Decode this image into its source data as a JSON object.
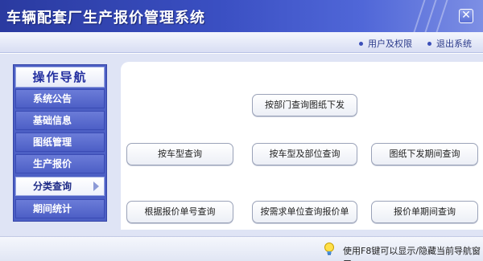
{
  "window": {
    "title": "车辆配套厂生产报价管理系统",
    "close_glyph": "✕"
  },
  "toplinks": [
    {
      "label": "用户及权限"
    },
    {
      "label": "退出系统"
    }
  ],
  "nav": {
    "header": "操作导航",
    "items": [
      {
        "label": "系统公告"
      },
      {
        "label": "基础信息"
      },
      {
        "label": "图纸管理"
      },
      {
        "label": "生产报价"
      },
      {
        "label": "分类查询",
        "active": true
      },
      {
        "label": "期间统计"
      }
    ]
  },
  "queries": [
    {
      "label": "按部门查询图纸下发"
    },
    {
      "label": "按车型查询"
    },
    {
      "label": "按车型及部位查询"
    },
    {
      "label": "图纸下发期间查询"
    },
    {
      "label": "根据报价单号查询"
    },
    {
      "label": "按需求单位查询报价单"
    },
    {
      "label": "报价单期间查询"
    }
  ],
  "status": {
    "hint": "使用F8键可以显示/隐藏当前导航窗口",
    "icon": "lightbulb-icon"
  },
  "colors": {
    "title_bar": "#3a4fc2",
    "nav_background": "#4c5fc4",
    "nav_header_text": "#2430a0",
    "work_area": "#dfe4f5"
  }
}
